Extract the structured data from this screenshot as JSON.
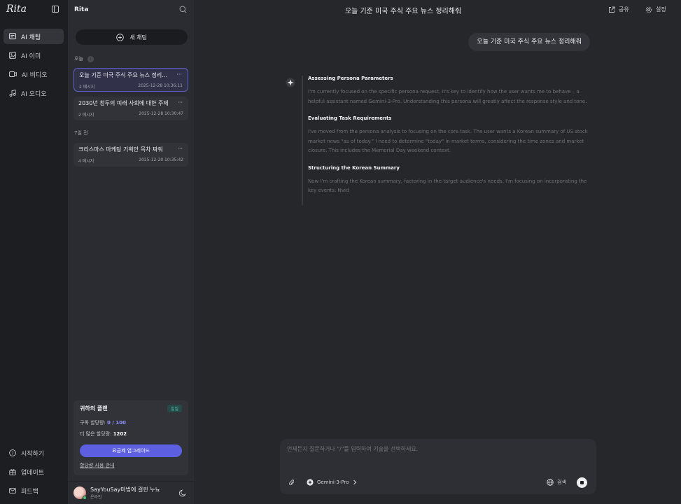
{
  "app": {
    "name": "Rita"
  },
  "rail": {
    "items": [
      {
        "label": "AI 채팅",
        "icon": "chat-icon",
        "active": true
      },
      {
        "label": "AI 이미",
        "icon": "image-icon",
        "active": false
      },
      {
        "label": "AI 비디오",
        "icon": "video-icon",
        "active": false
      },
      {
        "label": "AI 오디오",
        "icon": "music-icon",
        "active": false
      }
    ],
    "footer": [
      {
        "label": "시작하기",
        "icon": "help-icon"
      },
      {
        "label": "업데이트",
        "icon": "gift-icon"
      },
      {
        "label": "피드백",
        "icon": "mail-icon"
      }
    ]
  },
  "panel": {
    "title": "Rita",
    "new_chat": "새 채팅",
    "groups": [
      {
        "label": "오늘",
        "items": [
          {
            "title": "오늘 기준 미국 주식 주요 뉴스 정리해줘",
            "count": "2 메시지",
            "time": "2025-12-28 10:36:11",
            "active": true
          },
          {
            "title": "2030년 청두의 미래 사회에 대한 주제",
            "count": "2 메시지",
            "time": "2025-12-28 10:30:47",
            "active": false
          }
        ]
      },
      {
        "label": "7일 전",
        "items": [
          {
            "title": "크리스마스 마케팅 기획안 목차 짜줘",
            "count": "4 메시지",
            "time": "2025-12-20 10:35:42",
            "active": false
          }
        ]
      }
    ],
    "plan": {
      "title": "귀하의 플랜",
      "badge": "일일",
      "quota_label": "구독 할당량:",
      "quota_value": "0 / 100",
      "extra_label": "더 많은 할당량:",
      "extra_value": "1202",
      "upgrade": "요금제 업그레이드",
      "guide": "할당량 사용 안내"
    },
    "user": {
      "name": "SayYouSay마법에 걸린 누뇨",
      "status": "온라인"
    }
  },
  "main": {
    "title": "오늘 기준 미국 주식 주요 뉴스 정리해줘",
    "share": "공유",
    "settings": "설정",
    "user_message": "오늘 기준 미국 주식 주요 뉴스 정리해줘",
    "thinking": [
      {
        "heading": "Assessing Persona Parameters",
        "body": "I'm currently focused on the specific persona request. It's key to identify how the user wants me to behave – a helpful assistant named Gemini-3-Pro. Understanding this persona will greatly affect the response style and tone."
      },
      {
        "heading": "Evaluating Task Requirements",
        "body": "I've moved from the persona analysis to focusing on the core task. The user wants a Korean summary of US stock market news \"as of today.\" I need to determine \"today\" in market terms, considering the time zones and market closure. This includes the Memorial Day weekend context."
      },
      {
        "heading": "Structuring the Korean Summary",
        "body": "Now I'm crafting the Korean summary, factoring in the target audience's needs. I'm focusing on incorporating the key events: Nvid"
      }
    ],
    "composer": {
      "placeholder": "언제든지 질문하거나 \"/\"를 입력하여 기술을 선택하세요.",
      "model": "Gemini-3-Pro",
      "web_search": "검색"
    }
  },
  "colors": {
    "accent": "#5b5fe0",
    "active_border": "#5e61c9",
    "badge": "#58c8b8"
  }
}
